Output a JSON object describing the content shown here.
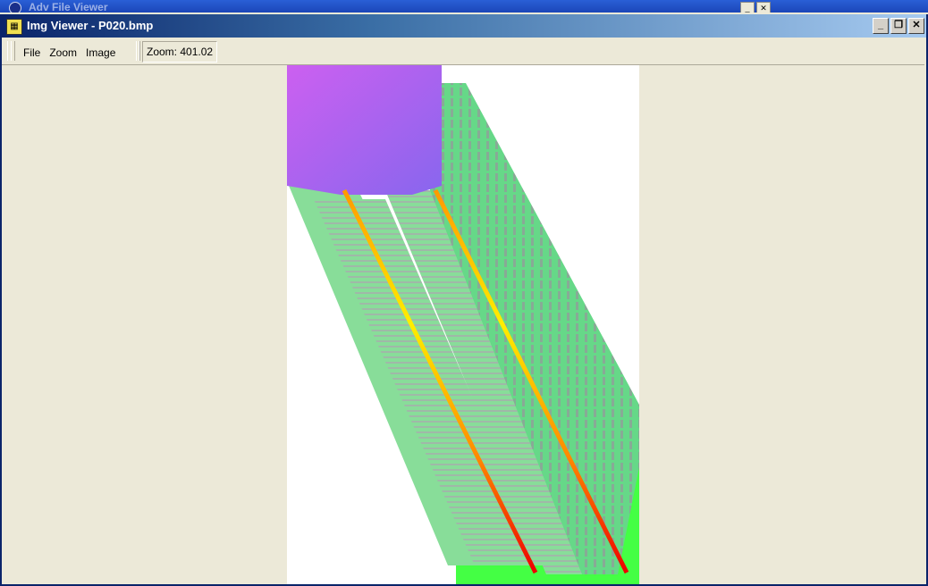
{
  "background_window": {
    "title": "Adv File Viewer"
  },
  "window": {
    "title": "Img Viewer - P020.bmp",
    "controls": {
      "minimize": "_",
      "restore": "❐",
      "close": "✕"
    }
  },
  "menu": {
    "items": [
      {
        "label": "File"
      },
      {
        "label": "Zoom"
      },
      {
        "label": "Image"
      }
    ]
  },
  "status": {
    "zoom": "Zoom: 401.02"
  },
  "colors": {
    "chrome": "#ece9d8",
    "title_start": "#0a246a",
    "title_end": "#a6caf0",
    "purple": "#b060f0",
    "green": "#44ff44",
    "band": "#88dd99",
    "yellow": "#ffee00",
    "red": "#ee0000"
  }
}
